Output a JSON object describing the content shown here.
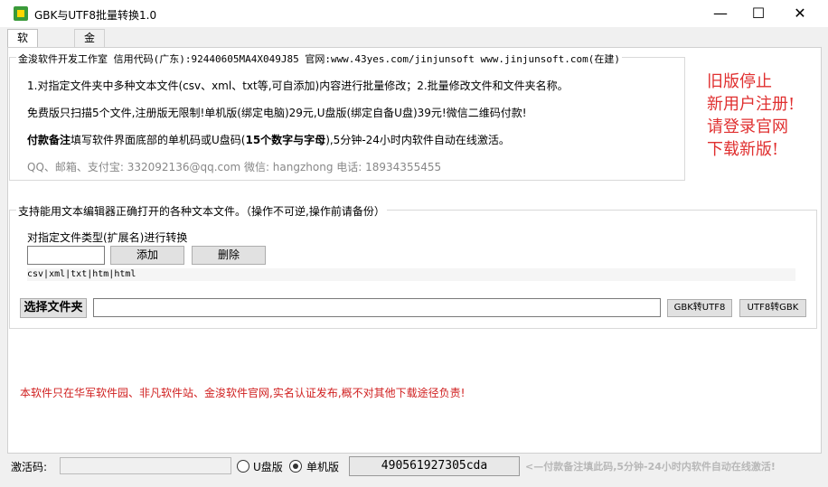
{
  "window": {
    "title": "GBK与UTF8批量转换1.0",
    "minimize": "—",
    "maximize": "☐",
    "close": "✕"
  },
  "tabs": [
    "软件设置",
    "金浚软件"
  ],
  "info": {
    "legend": "金浚软件开发工作室 信用代码(广东):92440605MA4X049J85 官网:www.43yes.com/jinjunsoft  www.jinjunsoft.com(在建)",
    "line1": "1.对指定文件夹中多种文本文件(csv、xml、txt等,可自添加)内容进行批量修改；2.批量修改文件和文件夹名称。",
    "line2": "免费版只扫描5个文件,注册版无限制!单机版(绑定电脑)29元,U盘版(绑定自备U盘)39元!微信二维码付款!",
    "line3_bold": "付款备注",
    "line3_mid": "填写软件界面底部的单机码或U盘码(",
    "line3_bold2": "15个数字与字母",
    "line3_end": "),5分钟-24小时内软件自动在线激活。",
    "contact": "QQ、邮箱、支付宝: 332092136@qq.com    微信: hangzhong    电话: 18934355455"
  },
  "side_notice": [
    "旧版停止",
    "新用户注册!",
    "请登录官网",
    "下载新版!"
  ],
  "convert": {
    "legend": "支持能用文本编辑器正确打开的各种文本文件。（操作不可逆,操作前请备份）",
    "type_label": "对指定文件类型(扩展名)进行转换",
    "ext_input": "",
    "add_label": "添加",
    "delete_label": "删除",
    "ext_list": "csv|xml|txt|htm|html",
    "choose_folder": "选择文件夹",
    "folder_path": "",
    "gbk_to_utf8": "GBK转UTF8",
    "utf8_to_gbk": "UTF8转GBK"
  },
  "notice": "本软件只在华军软件园、非凡软件站、金浚软件官网,实名认证发布,概不对其他下载途径负责!",
  "status": {
    "activation_label": "激活码:",
    "activation_value": "",
    "usb_label": "U盘版",
    "pc_label": "单机版",
    "machine_code": "490561927305cda",
    "hint": "<—付款备注填此码,5分钟-24小时内软件自动在线激活!"
  },
  "colors": {
    "accent_red": "#e03030"
  }
}
